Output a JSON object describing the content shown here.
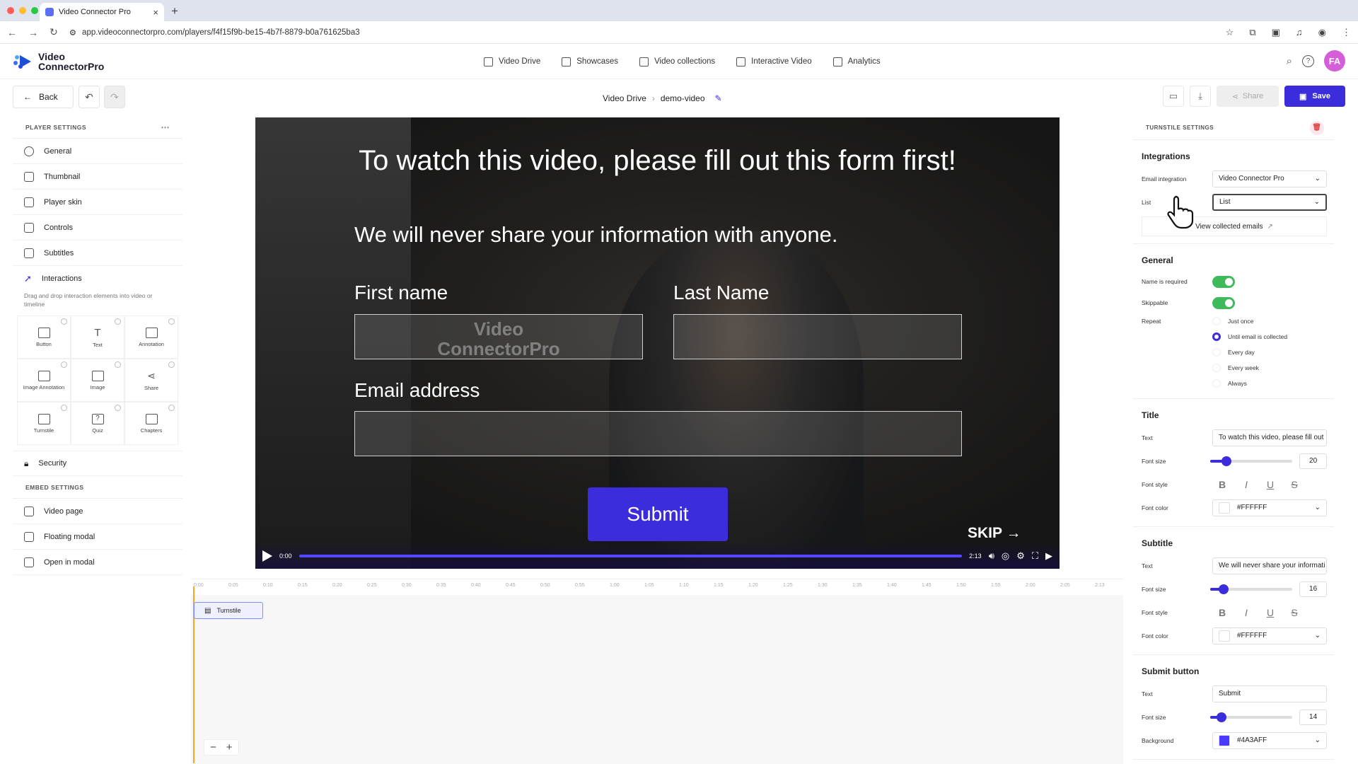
{
  "browser": {
    "tab_title": "Video Connector Pro",
    "url": "app.videoconnectorpro.com/players/f4f15f9b-be15-4b7f-8879-b0a761625ba3"
  },
  "app": {
    "logo_line1": "Video",
    "logo_line2": "ConnectorPro",
    "nav": [
      "Video Drive",
      "Showcases",
      "Video collections",
      "Interactive Video",
      "Analytics"
    ],
    "avatar": "FA"
  },
  "toolbar": {
    "back_label": "Back",
    "breadcrumb_root": "Video Drive",
    "breadcrumb_current": "demo-video",
    "share_label": "Share",
    "save_label": "Save"
  },
  "left_panel": {
    "player_settings_title": "PLAYER SETTINGS",
    "items": [
      "General",
      "Thumbnail",
      "Player skin",
      "Controls",
      "Subtitles",
      "Interactions"
    ],
    "interactions_hint": "Drag and drop interaction elements into video or timeline",
    "elements": [
      "Button",
      "Text",
      "Annotation",
      "Image Annotation",
      "Image",
      "Share",
      "Turnstile",
      "Quiz",
      "Chapters"
    ],
    "security_label": "Security",
    "embed_settings_title": "EMBED SETTINGS",
    "embed_items": [
      "Video page",
      "Floating modal",
      "Open in modal"
    ]
  },
  "video": {
    "title": "To watch this video, please fill out this form first!",
    "subtitle": "We will never share your information with anyone.",
    "first_name_label": "First name",
    "last_name_label": "Last Name",
    "email_label": "Email address",
    "submit_label": "Submit",
    "skip_label": "SKIP →",
    "current_time": "0:00",
    "duration": "2:13",
    "watermark_line1": "Video",
    "watermark_line2": "ConnectorPro"
  },
  "timeline": {
    "ticks": [
      "0:00",
      "0:05",
      "0:10",
      "0:15",
      "0:20",
      "0:25",
      "0:30",
      "0:35",
      "0:40",
      "0:45",
      "0:50",
      "0:55",
      "1:00",
      "1:05",
      "1:10",
      "1:15",
      "1:20",
      "1:25",
      "1:30",
      "1:35",
      "1:40",
      "1:45",
      "1:50",
      "1:55",
      "2:00",
      "2:05",
      "2:13"
    ],
    "chip_label": "Turnstile"
  },
  "right_panel": {
    "title": "TURNSTILE SETTINGS",
    "integrations": {
      "heading": "Integrations",
      "email_integration_label": "Email integration",
      "email_integration_value": "Video Connector Pro",
      "list_label": "List",
      "list_value": "List",
      "view_emails": "View collected emails"
    },
    "general": {
      "heading": "General",
      "name_required_label": "Name is required",
      "skippable_label": "Skippable",
      "repeat_label": "Repeat",
      "repeat_options": [
        "Just once",
        "Until email is collected",
        "Every day",
        "Every week",
        "Always"
      ],
      "repeat_selected": "Until email is collected"
    },
    "title_section": {
      "heading": "Title",
      "text_label": "Text",
      "text_value": "To watch this video, please fill out",
      "font_size_label": "Font size",
      "font_size": "20",
      "font_size_fraction": 0.2,
      "font_style_label": "Font style",
      "font_color_label": "Font color",
      "font_color": "#FFFFFF"
    },
    "subtitle_section": {
      "heading": "Subtitle",
      "text_label": "Text",
      "text_value": "We will never share your informati",
      "font_size_label": "Font size",
      "font_size": "16",
      "font_size_fraction": 0.16,
      "font_style_label": "Font style",
      "font_color_label": "Font color",
      "font_color": "#FFFFFF"
    },
    "submit_section": {
      "heading": "Submit button",
      "text_label": "Text",
      "text_value": "Submit",
      "font_size_label": "Font size",
      "font_size": "14",
      "font_size_fraction": 0.14,
      "background_label": "Background",
      "background_color": "#4A3AFF"
    }
  },
  "colors": {
    "accent": "#3b2ddb",
    "toggle_on": "#3fba5a"
  }
}
